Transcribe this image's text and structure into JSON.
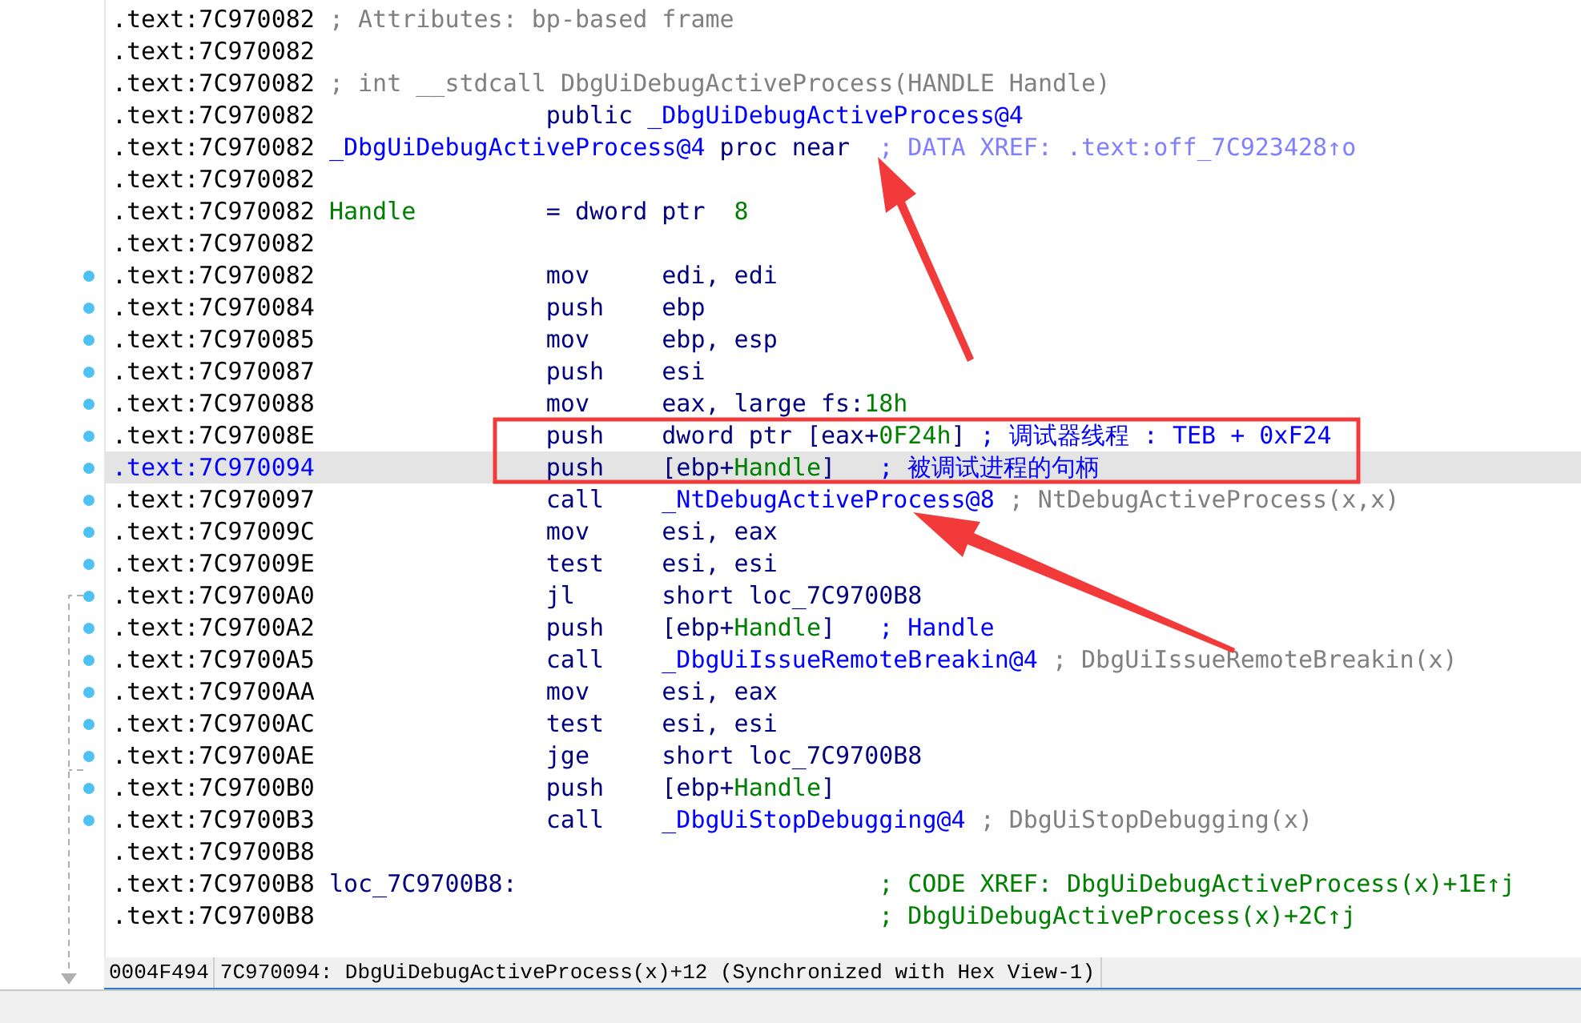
{
  "listing": [
    {
      "address": ".text:7C970082",
      "kind": "header",
      "marker": false,
      "selected": false,
      "comment": {
        "text": "; Attributes: bp-based frame",
        "kind": "auto"
      }
    },
    {
      "address": ".text:7C970082",
      "kind": "code",
      "marker": false,
      "selected": false
    },
    {
      "address": ".text:7C970082",
      "kind": "header",
      "marker": false,
      "selected": false,
      "comment": {
        "text": "; int __stdcall DbgUiDebugActiveProcess(HANDLE Handle)",
        "kind": "auto"
      }
    },
    {
      "address": ".text:7C970082",
      "kind": "code",
      "marker": false,
      "selected": false,
      "operands": [
        {
          "text": "public ",
          "kind": "keyword"
        },
        {
          "text": "_DbgUiDebugActiveProcess@4",
          "kind": "name"
        }
      ]
    },
    {
      "address": ".text:7C970082",
      "kind": "code",
      "marker": false,
      "selected": false,
      "label": {
        "text": "_DbgUiDebugActiveProcess@4",
        "kind": "name"
      },
      "operands": [
        {
          "text": "proc near",
          "kind": "keyword"
        }
      ],
      "comment": {
        "text": "; DATA XREF: .text:off_7C923428↑o",
        "kind": "data_xref"
      }
    },
    {
      "address": ".text:7C970082",
      "kind": "code",
      "marker": false,
      "selected": false
    },
    {
      "address": ".text:7C970082",
      "kind": "code",
      "marker": false,
      "selected": false,
      "label": {
        "text": "Handle",
        "kind": "var"
      },
      "operands": [
        {
          "text": "= dword ptr  ",
          "kind": "plain"
        },
        {
          "text": "8",
          "kind": "number"
        }
      ]
    },
    {
      "address": ".text:7C970082",
      "kind": "code",
      "marker": false,
      "selected": false
    },
    {
      "address": ".text:7C970082",
      "kind": "code",
      "marker": true,
      "selected": false,
      "mnemonic": "mov",
      "operands": [
        {
          "text": "edi, edi",
          "kind": "plain"
        }
      ]
    },
    {
      "address": ".text:7C970084",
      "kind": "code",
      "marker": true,
      "selected": false,
      "mnemonic": "push",
      "operands": [
        {
          "text": "ebp",
          "kind": "plain"
        }
      ]
    },
    {
      "address": ".text:7C970085",
      "kind": "code",
      "marker": true,
      "selected": false,
      "mnemonic": "mov",
      "operands": [
        {
          "text": "ebp, esp",
          "kind": "plain"
        }
      ]
    },
    {
      "address": ".text:7C970087",
      "kind": "code",
      "marker": true,
      "selected": false,
      "mnemonic": "push",
      "operands": [
        {
          "text": "esi",
          "kind": "plain"
        }
      ]
    },
    {
      "address": ".text:7C970088",
      "kind": "code",
      "marker": true,
      "selected": false,
      "mnemonic": "mov",
      "operands": [
        {
          "text": "eax, large fs:",
          "kind": "plain"
        },
        {
          "text": "18h",
          "kind": "number"
        }
      ]
    },
    {
      "address": ".text:7C97008E",
      "kind": "code",
      "marker": true,
      "selected": false,
      "mnemonic": "push",
      "operands": [
        {
          "text": "dword ptr [eax+",
          "kind": "plain"
        },
        {
          "text": "0F24h",
          "kind": "number"
        },
        {
          "text": "]",
          "kind": "plain"
        }
      ],
      "comment": {
        "text": "; 调试器线程 : TEB + 0xF24",
        "kind": "user"
      }
    },
    {
      "address": ".text:7C970094",
      "kind": "code",
      "marker": true,
      "selected": true,
      "mnemonic": "push",
      "operands": [
        {
          "text": "[ebp+",
          "kind": "plain"
        },
        {
          "text": "Handle",
          "kind": "var"
        },
        {
          "text": "]",
          "kind": "plain"
        }
      ],
      "comment": {
        "text": "; 被调试进程的句柄",
        "kind": "user"
      }
    },
    {
      "address": ".text:7C970097",
      "kind": "code",
      "marker": true,
      "selected": false,
      "mnemonic": "call",
      "operands": [
        {
          "text": "_NtDebugActiveProcess@8",
          "kind": "name"
        }
      ],
      "comment": {
        "text": "; NtDebugActiveProcess(x,x)",
        "kind": "auto"
      }
    },
    {
      "address": ".text:7C97009C",
      "kind": "code",
      "marker": true,
      "selected": false,
      "mnemonic": "mov",
      "operands": [
        {
          "text": "esi, eax",
          "kind": "plain"
        }
      ]
    },
    {
      "address": ".text:7C97009E",
      "kind": "code",
      "marker": true,
      "selected": false,
      "mnemonic": "test",
      "operands": [
        {
          "text": "esi, esi",
          "kind": "plain"
        }
      ]
    },
    {
      "address": ".text:7C9700A0",
      "kind": "code",
      "marker": true,
      "selected": false,
      "mnemonic": "jl",
      "operands": [
        {
          "text": "short loc_7C9700B8",
          "kind": "plain"
        }
      ]
    },
    {
      "address": ".text:7C9700A2",
      "kind": "code",
      "marker": true,
      "selected": false,
      "mnemonic": "push",
      "operands": [
        {
          "text": "[ebp+",
          "kind": "plain"
        },
        {
          "text": "Handle",
          "kind": "var"
        },
        {
          "text": "]",
          "kind": "plain"
        }
      ],
      "comment": {
        "text": "; Handle",
        "kind": "user"
      }
    },
    {
      "address": ".text:7C9700A5",
      "kind": "code",
      "marker": true,
      "selected": false,
      "mnemonic": "call",
      "operands": [
        {
          "text": "_DbgUiIssueRemoteBreakin@4",
          "kind": "name"
        }
      ],
      "comment": {
        "text": "; DbgUiIssueRemoteBreakin(x)",
        "kind": "auto"
      }
    },
    {
      "address": ".text:7C9700AA",
      "kind": "code",
      "marker": true,
      "selected": false,
      "mnemonic": "mov",
      "operands": [
        {
          "text": "esi, eax",
          "kind": "plain"
        }
      ]
    },
    {
      "address": ".text:7C9700AC",
      "kind": "code",
      "marker": true,
      "selected": false,
      "mnemonic": "test",
      "operands": [
        {
          "text": "esi, esi",
          "kind": "plain"
        }
      ]
    },
    {
      "address": ".text:7C9700AE",
      "kind": "code",
      "marker": true,
      "selected": false,
      "mnemonic": "jge",
      "operands": [
        {
          "text": "short loc_7C9700B8",
          "kind": "plain"
        }
      ]
    },
    {
      "address": ".text:7C9700B0",
      "kind": "code",
      "marker": true,
      "selected": false,
      "mnemonic": "push",
      "operands": [
        {
          "text": "[ebp+",
          "kind": "plain"
        },
        {
          "text": "Handle",
          "kind": "var"
        },
        {
          "text": "]",
          "kind": "plain"
        }
      ]
    },
    {
      "address": ".text:7C9700B3",
      "kind": "code",
      "marker": true,
      "selected": false,
      "mnemonic": "call",
      "operands": [
        {
          "text": "_DbgUiStopDebugging@4",
          "kind": "name"
        }
      ],
      "comment": {
        "text": "; DbgUiStopDebugging(x)",
        "kind": "auto"
      }
    },
    {
      "address": ".text:7C9700B8",
      "kind": "code",
      "marker": false,
      "selected": false
    },
    {
      "address": ".text:7C9700B8",
      "kind": "code",
      "marker": false,
      "selected": false,
      "label": {
        "text": "loc_7C9700B8:",
        "kind": "plain"
      },
      "comment": {
        "text": "; CODE XREF: DbgUiDebugActiveProcess(x)+1E↑j",
        "kind": "code_xref"
      }
    },
    {
      "address": ".text:7C9700B8",
      "kind": "code",
      "marker": false,
      "selected": false,
      "comment": {
        "text": "; DbgUiDebugActiveProcess(x)+2C↑j",
        "kind": "code_xref"
      }
    }
  ],
  "status_bar": {
    "offset": "0004F494",
    "location": "7C970094: DbgUiDebugActiveProcess(x)+12 (Synchronized with Hex View-1)"
  }
}
